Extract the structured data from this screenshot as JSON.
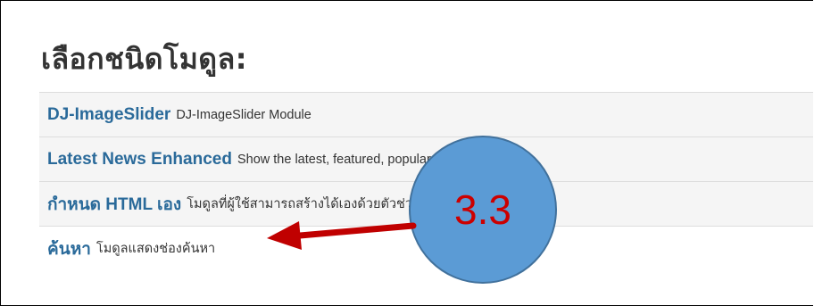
{
  "page": {
    "heading": "เลือกชนิดโมดูล:"
  },
  "modules": [
    {
      "title": "DJ-ImageSlider",
      "description": "DJ-ImageSlider Module"
    },
    {
      "title": "Latest News Enhanced",
      "description": "Show the latest, featured, popular or related news"
    },
    {
      "title": "กำหนด HTML เอง",
      "description": "โมดูลที่ผู้ใช้สามารถสร้างได้เองด้วยตัวช่วยเขียนเนื้อหา WYSIWYG"
    },
    {
      "title": "ค้นหา",
      "description": "โมดูลแสดงช่องค้นหา"
    }
  ],
  "annotation": {
    "label": "3.3",
    "circle_color": "#5b9bd5",
    "arrow_color": "#c00000",
    "text_color": "#cc0000"
  }
}
